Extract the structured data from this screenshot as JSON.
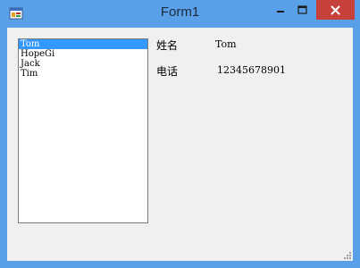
{
  "window": {
    "title": "Form1",
    "controls": {
      "minimize": "minimize",
      "maximize": "maximize",
      "close": "close"
    }
  },
  "listbox": {
    "items": [
      {
        "label": "Tom",
        "selected": true
      },
      {
        "label": "HopeGi",
        "selected": false
      },
      {
        "label": "Jack",
        "selected": false
      },
      {
        "label": "Tim",
        "selected": false
      }
    ]
  },
  "details": {
    "name_label": "姓名",
    "name_value": "Tom",
    "phone_label": "电话",
    "phone_value": "12345678901"
  },
  "colors": {
    "frame": "#5aa0e8",
    "client_bg": "#f0f0f0",
    "selection": "#3399ff",
    "close_button": "#c7403a"
  }
}
